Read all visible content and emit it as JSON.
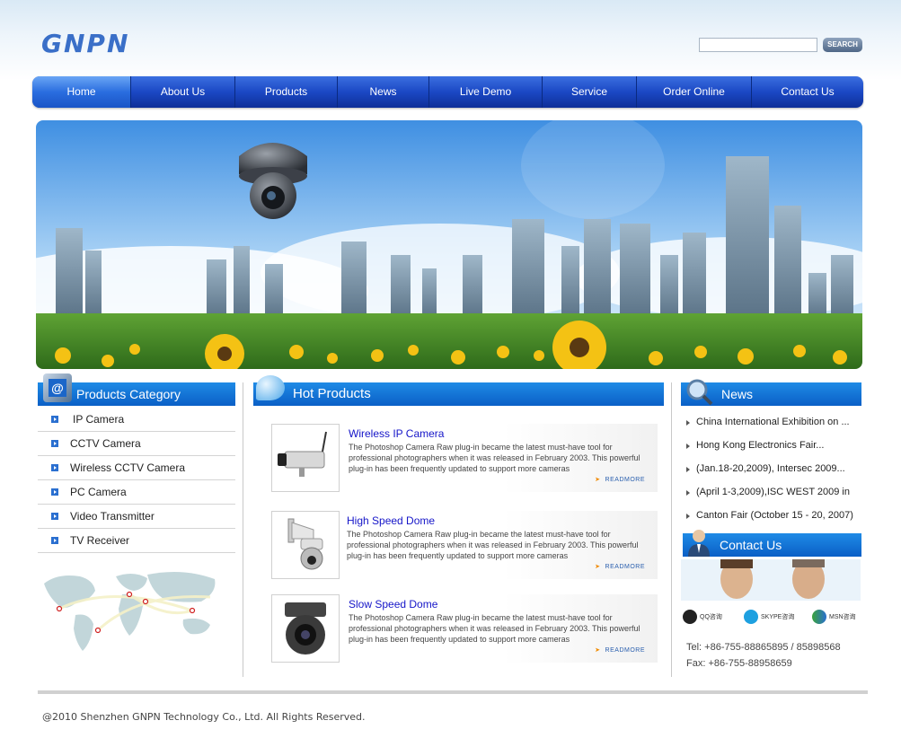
{
  "header": {
    "logo": "GNPN",
    "search_button": "SEARCH",
    "search_value": ""
  },
  "nav": {
    "items": [
      "Home",
      "About  Us",
      "Products",
      "News",
      "Live Demo",
      "Service",
      "Order Online",
      "Contact Us"
    ],
    "active": "Home"
  },
  "categories": {
    "title": "Products Category",
    "items": [
      "IP Camera",
      "CCTV Camera",
      "Wireless CCTV Camera",
      "PC Camera",
      "Video Transmitter",
      "TV Receiver"
    ]
  },
  "hot_products": {
    "title": "Hot Products",
    "items": [
      {
        "title": "Wireless IP Camera",
        "description": "The Photoshop Camera Raw plug-in became the latest must-have tool for professional photographers when it was released in February 2003. This powerful plug-in has been frequently updated to support more cameras",
        "more": "READMORE"
      },
      {
        "title": "High Speed Dome",
        "description": "The Photoshop Camera Raw plug-in became the latest must-have tool for professional photographers when it was released in February 2003. This powerful plug-in has been frequently updated to support more cameras",
        "more": "READMORE"
      },
      {
        "title": "Slow Speed Dome",
        "description": "The Photoshop Camera Raw plug-in became the latest must-have tool for professional photographers when it was released in February 2003. This powerful plug-in has been frequently updated to support more cameras",
        "more": "READMORE"
      }
    ]
  },
  "news": {
    "title": "News",
    "items": [
      "China International Exhibition on ...",
      "Hong Kong Electronics Fair...",
      "(Jan.18-20,2009), Intersec 2009...",
      "(April 1-3,2009),ISC WEST 2009 in",
      "Canton Fair (October 15 - 20, 2007)"
    ]
  },
  "contact": {
    "title": "Contact Us",
    "qq": "QQ咨询",
    "skype": "SKYPE咨询",
    "msn": "MSN咨询",
    "tel": "Tel:  +86-755-88865895 / 85898568",
    "fax": "Fax: +86-755-88958659"
  },
  "footer": {
    "copyright": "@2010 Shenzhen GNPN Technology Co., Ltd. All Rights Reserved."
  },
  "colors": {
    "nav": "#1b48c4",
    "section_header": "#0a5fc6",
    "product_title": "#1515c8"
  }
}
